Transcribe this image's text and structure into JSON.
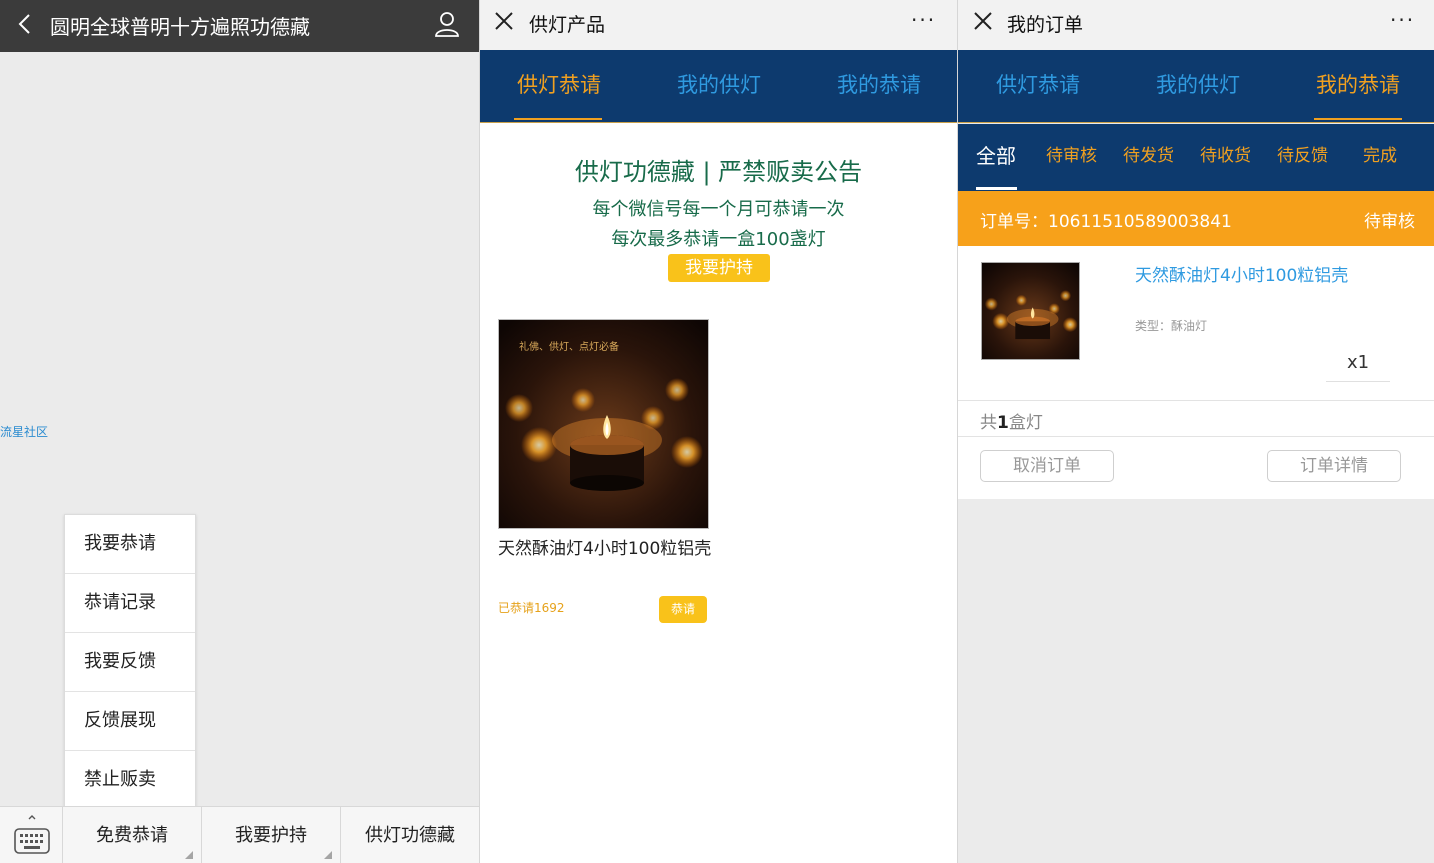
{
  "panel1": {
    "title": "圆明全球普明十方遍照功德藏",
    "side_link": "流星社区",
    "menu_items": [
      {
        "label": "我要恭请"
      },
      {
        "label": "恭请记录"
      },
      {
        "label": "我要反馈"
      },
      {
        "label": "反馈展现"
      },
      {
        "label": "禁止贩卖"
      }
    ],
    "bottom_tabs": [
      {
        "label": "免费恭请"
      },
      {
        "label": "我要护持"
      },
      {
        "label": "供灯功德藏"
      }
    ],
    "icons": {
      "back": "chevron-left-icon",
      "user": "user-icon",
      "keyboard": "keyboard-icon"
    }
  },
  "panel2": {
    "title": "供灯产品",
    "more": "···",
    "nav_tabs": [
      {
        "label": "供灯恭请",
        "active": true
      },
      {
        "label": "我的供灯",
        "active": false
      },
      {
        "label": "我的恭请",
        "active": false
      }
    ],
    "notice": {
      "title": "供灯功德藏 | 严禁贩卖公告",
      "line1": "每个微信号每一个月可恭请一次",
      "line2": "每次最多恭请一盒100盏灯",
      "button": "我要护持"
    },
    "product": {
      "image_caption": "礼佛、供灯、点灯必备",
      "name": "天然酥油灯4小时100粒铝壳",
      "count": "已恭请1692",
      "button": "恭请"
    }
  },
  "panel3": {
    "title": "我的订单",
    "more": "···",
    "nav_tabs": [
      {
        "label": "供灯恭请",
        "active": false
      },
      {
        "label": "我的供灯",
        "active": false
      },
      {
        "label": "我的恭请",
        "active": true
      }
    ],
    "sub_tabs": [
      {
        "label": "全部",
        "active": true
      },
      {
        "label": "待审核",
        "active": false
      },
      {
        "label": "待发货",
        "active": false
      },
      {
        "label": "待收货",
        "active": false
      },
      {
        "label": "待反馈",
        "active": false
      },
      {
        "label": "完成",
        "active": false
      }
    ],
    "order": {
      "number_label": "订单号：10611510589003841",
      "status": "待审核",
      "item_name": "天然酥油灯4小时100粒铝壳",
      "item_type": "类型：酥油灯",
      "quantity": "x1",
      "total_prefix": "共",
      "total_count": "1",
      "total_suffix": "盒灯",
      "cancel_button": "取消订单",
      "detail_button": "订单详情"
    }
  },
  "colors": {
    "nav_bg": "#0d3a6e",
    "nav_tab": "#2f9ae0",
    "accent_orange": "#f0a020",
    "order_bar": "#f7a11a",
    "button_yellow": "#f9c21a",
    "notice_green": "#186b4a"
  }
}
